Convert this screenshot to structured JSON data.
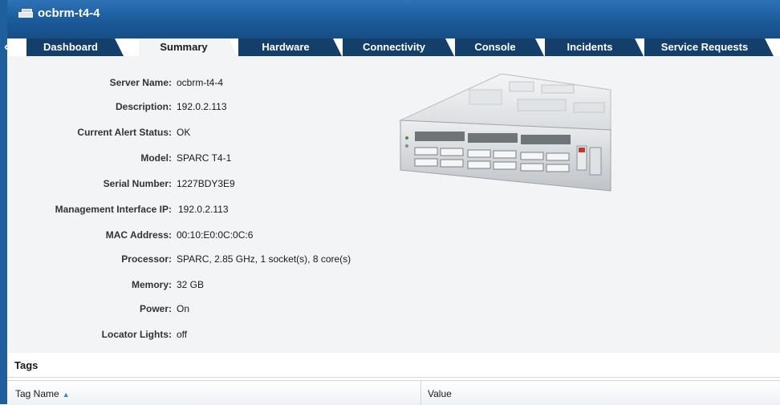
{
  "window": {
    "title": "ocbrm-t4-4"
  },
  "tabs": [
    {
      "label": "Dashboard",
      "active": false
    },
    {
      "label": "Summary",
      "active": true
    },
    {
      "label": "Hardware",
      "active": false
    },
    {
      "label": "Connectivity",
      "active": false
    },
    {
      "label": "Console",
      "active": false
    },
    {
      "label": "Incidents",
      "active": false
    },
    {
      "label": "Service Requests",
      "active": false
    }
  ],
  "summary": [
    {
      "label": "Server Name:",
      "value": "ocbrm-t4-4"
    },
    {
      "label": "Description:",
      "value": "192.0.2.113"
    },
    {
      "label": "Current Alert Status:",
      "value": "OK"
    },
    {
      "label": "Model:",
      "value": "SPARC T4-1"
    },
    {
      "label": "Serial Number:",
      "value": "1227BDY3E9"
    },
    {
      "label": "Management Interface IP:",
      "value": "192.0.2.113"
    },
    {
      "label": "MAC Address:",
      "value": "00:10:E0:0C:0C:6"
    },
    {
      "label": "Processor:",
      "value": "SPARC, 2.85 GHz, 1 socket(s), 8 core(s)"
    },
    {
      "label": "Memory:",
      "value": "32 GB"
    },
    {
      "label": "Power:",
      "value": "On"
    },
    {
      "label": "Locator Lights:",
      "value": "off"
    }
  ],
  "tags": {
    "title": "Tags",
    "columns": [
      "Tag Name",
      "Value"
    ]
  },
  "icons": {
    "server": "server-icon",
    "collapse": "double-chevron-left-icon",
    "sort": "sort-ascending-icon"
  },
  "colors": {
    "header_blue": "#1b5a99",
    "tab_dark": "#143f6b",
    "content_bg": "#f2f4f6"
  }
}
